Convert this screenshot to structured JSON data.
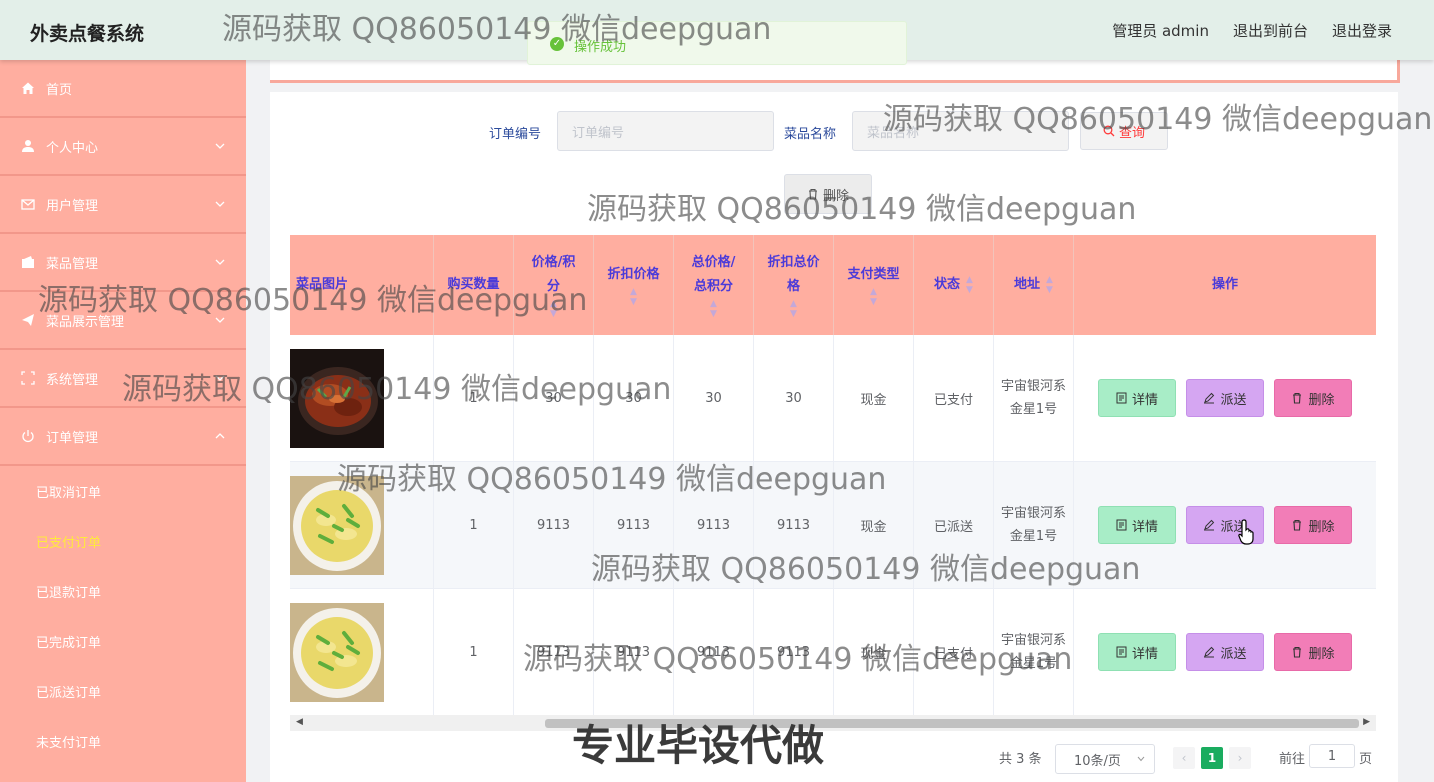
{
  "header": {
    "app_title": "外卖点餐系统",
    "admin_label": "管理员 admin",
    "to_front": "退出到前台",
    "logout": "退出登录"
  },
  "toast": {
    "message": "操作成功"
  },
  "sidebar": {
    "items": [
      {
        "label": "首页",
        "icon": "home-icon"
      },
      {
        "label": "个人中心",
        "icon": "user-icon"
      },
      {
        "label": "用户管理",
        "icon": "mail-icon"
      },
      {
        "label": "菜品管理",
        "icon": "wallet-icon"
      },
      {
        "label": "菜品展示管理",
        "icon": "send-icon"
      },
      {
        "label": "系统管理",
        "icon": "fullscreen-icon"
      },
      {
        "label": "订单管理",
        "icon": "power-icon"
      }
    ],
    "sub_items": [
      "已取消订单",
      "已支付订单",
      "已退款订单",
      "已完成订单",
      "已派送订单",
      "未支付订单"
    ],
    "active_sub": "已支付订单"
  },
  "search": {
    "order_no_label": "订单编号",
    "order_no_placeholder": "订单编号",
    "dish_name_label": "菜品名称",
    "dish_name_placeholder": "菜品名称",
    "query_button": "查询",
    "delete_button": "删除"
  },
  "table": {
    "headers": [
      "菜品图片",
      "购买数量",
      "价格/积分",
      "折扣价格",
      "总价格/总积分",
      "折扣总价格",
      "支付类型",
      "状态",
      "地址",
      "操作"
    ],
    "rows": [
      {
        "image": "braised-fish",
        "qty": "1",
        "price": "30",
        "discount_price": "30",
        "total": "30",
        "discount_total": "30",
        "pay_type": "现金",
        "status": "已支付",
        "address": "宇宙银河系金星1号"
      },
      {
        "image": "egg-dish",
        "qty": "1",
        "price": "9113",
        "discount_price": "9113",
        "total": "9113",
        "discount_total": "9113",
        "pay_type": "现金",
        "status": "已派送",
        "address": "宇宙银河系金星1号"
      },
      {
        "image": "egg-dish",
        "qty": "1",
        "price": "9113",
        "discount_price": "9113",
        "total": "9113",
        "discount_total": "9113",
        "pay_type": "现金",
        "status": "已支付",
        "address": "宇宙银河系金星1号"
      }
    ],
    "actions": {
      "detail": "详情",
      "send": "派送",
      "delete": "删除"
    }
  },
  "pagination": {
    "total_text": "共 3 条",
    "page_size": "10条/页",
    "current_page": "1",
    "goto_label": "前往",
    "goto_value": "1",
    "page_suffix": "页"
  },
  "watermarks": {
    "text": "源码获取 QQ86050149 微信deepguan",
    "banner": "专业毕设代做"
  },
  "colors": {
    "sidebar_bg": "#ffaea0",
    "header_bg": "#e3efe9",
    "active_page": "#1aac5f",
    "header_text": "#4b3bd9"
  }
}
